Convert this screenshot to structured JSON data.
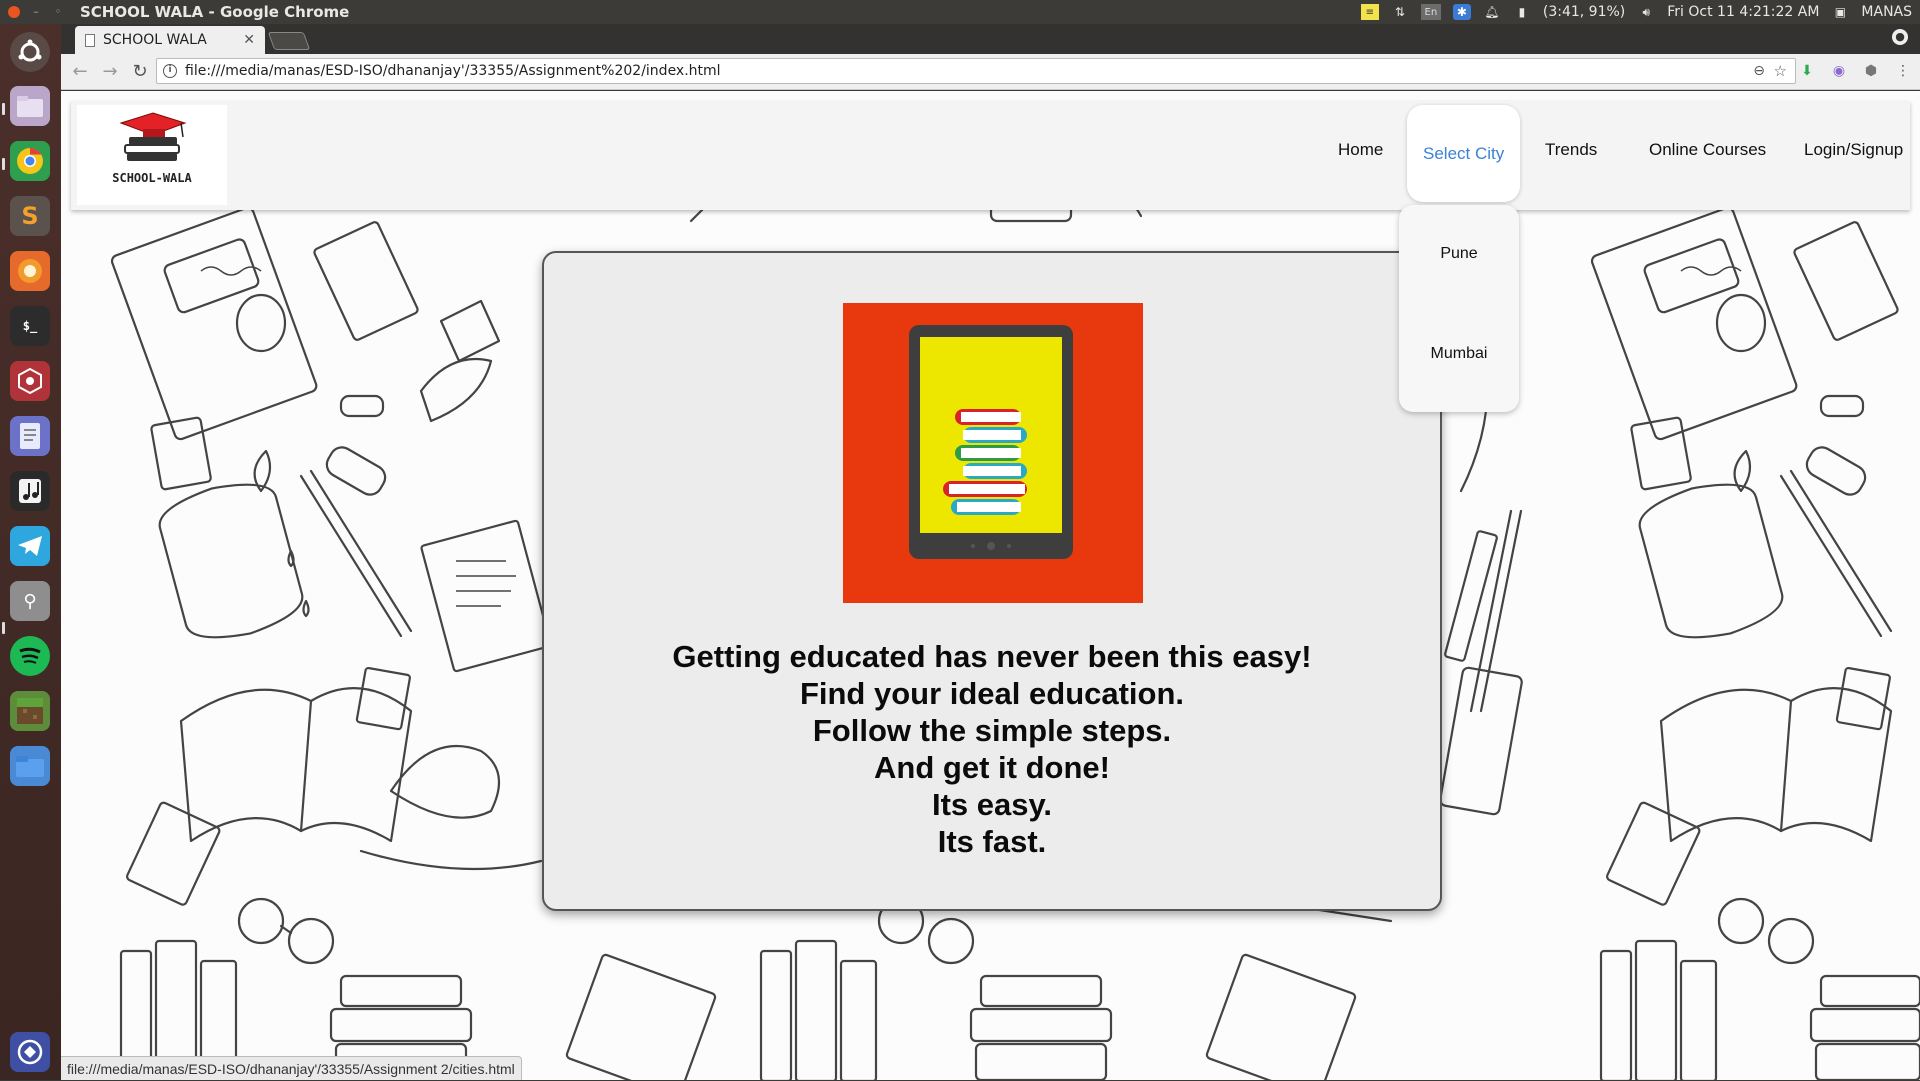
{
  "os_panel": {
    "app_title": "SCHOOL WALA - Google Chrome",
    "battery": "(3:41, 91%)",
    "datetime": "Fri Oct 11  4:21:22 AM",
    "user": "MANAS",
    "keyboard_layout": "En"
  },
  "launcher": {
    "items": [
      "ubuntu-dash",
      "files",
      "chrome",
      "sublime-text",
      "firefox",
      "terminal",
      "robomongo",
      "text-editor",
      "music",
      "telegram",
      "usb-drive",
      "spotify",
      "minecraft",
      "folder",
      "trash"
    ]
  },
  "browser": {
    "tab_title": "SCHOOL WALA",
    "url": "file:///media/manas/ESD-ISO/dhananjay'/33355/Assignment%202/index.html",
    "status_url": "file:///media/manas/ESD-ISO/dhananjay'/33355/Assignment 2/cities.html"
  },
  "site": {
    "logo_text": "SCHOOL-WALA",
    "nav": [
      {
        "label": "Home"
      },
      {
        "label": "Select City"
      },
      {
        "label": "Trends"
      },
      {
        "label": "Online Courses"
      },
      {
        "label": "Login/Signup"
      }
    ],
    "city_dropdown": [
      "Pune",
      "Mumbai"
    ],
    "tagline": [
      "Getting educated has never been this easy!",
      "Find your ideal education.",
      "Follow the simple steps.",
      "And get it done!",
      "Its easy.",
      "Its fast."
    ],
    "colors": {
      "hero_bg": "#e8380e",
      "tablet_screen": "#ede700",
      "active_nav": "#3b82d6",
      "launcher_bg": "#4b2f2a"
    }
  }
}
